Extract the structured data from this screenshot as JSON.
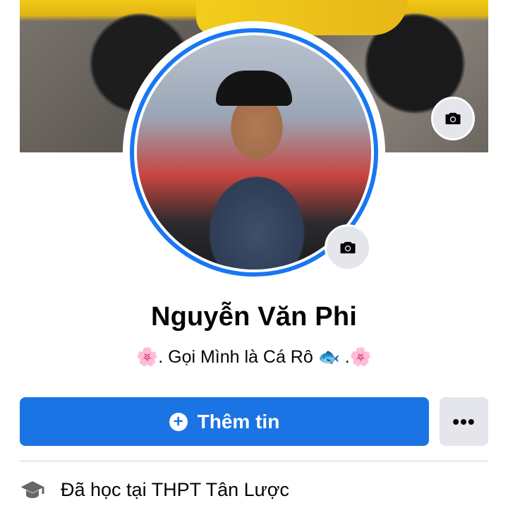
{
  "profile": {
    "name": "Nguyễn Văn Phi",
    "bio": "🌸. Gọi Mình là Cá Rô 🐟 .🌸"
  },
  "actions": {
    "primary_label": "Thêm tin",
    "more_label": "•••"
  },
  "info": {
    "education": "Đã học tại THPT Tân Lược"
  },
  "icons": {
    "cover_camera": "camera-icon",
    "avatar_camera": "camera-icon",
    "add": "plus-circle-icon",
    "education": "graduation-cap-icon"
  },
  "colors": {
    "accent": "#1b74e4",
    "ring": "#1877f2",
    "secondary_button": "#e4e6eb"
  }
}
